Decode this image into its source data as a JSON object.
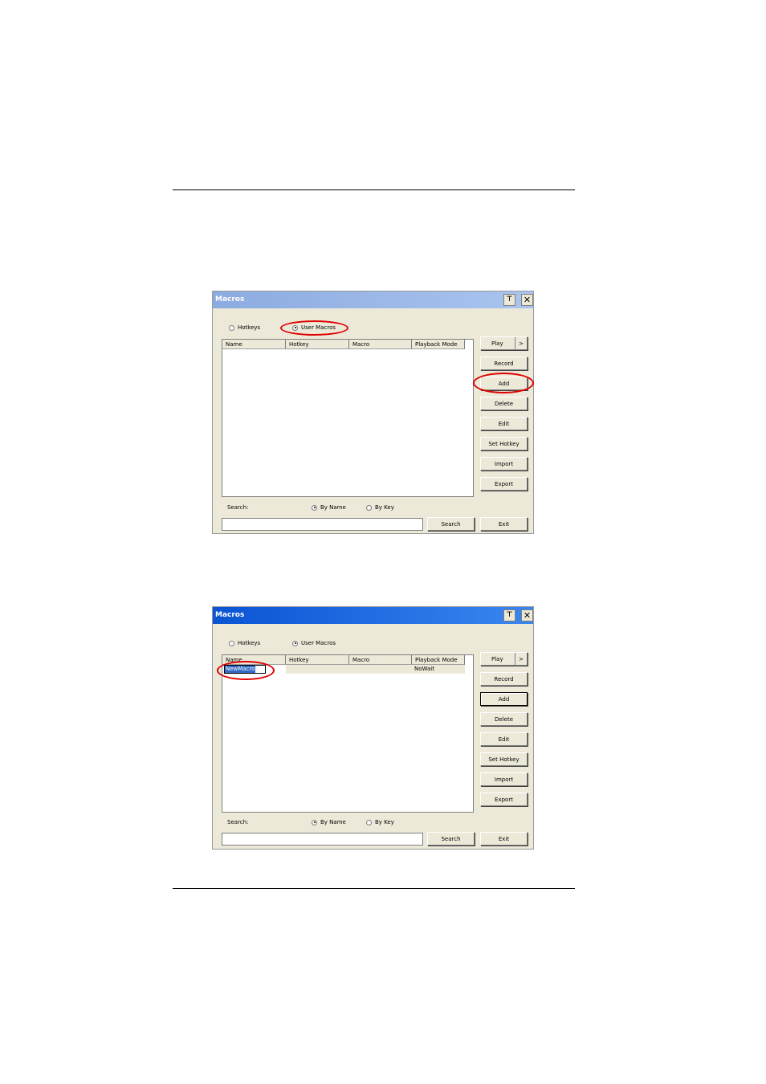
{
  "dialogs": [
    {
      "title": "Macros",
      "window_buttons": {
        "pin": "⊤",
        "close": "✕"
      },
      "radio_hotkeys": "Hotkeys",
      "radio_user_macros": "User Macros",
      "columns": [
        "Name",
        "Hotkey",
        "Macro",
        "Playback Mode"
      ],
      "row": null,
      "buttons": {
        "play": "Play",
        "play_arrow": ">",
        "record": "Record",
        "add": "Add",
        "delete": "Delete",
        "edit": "Edit",
        "set_hotkey": "Set Hotkey",
        "import": "Import",
        "export": "Export"
      },
      "search_label": "Search:",
      "by_name": "By Name",
      "by_key": "By Key",
      "search_value": "",
      "search_button": "Search",
      "exit_button": "Exit"
    },
    {
      "title": "Macros",
      "window_buttons": {
        "pin": "⊤",
        "close": "✕"
      },
      "radio_hotkeys": "Hotkeys",
      "radio_user_macros": "User Macros",
      "columns": [
        "Name",
        "Hotkey",
        "Macro",
        "Playback Mode"
      ],
      "row": {
        "name": "NewMacro",
        "hotkey": "",
        "macro": "",
        "playback_mode": "NoWait"
      },
      "buttons": {
        "play": "Play",
        "play_arrow": ">",
        "record": "Record",
        "add": "Add",
        "delete": "Delete",
        "edit": "Edit",
        "set_hotkey": "Set Hotkey",
        "import": "Import",
        "export": "Export"
      },
      "search_label": "Search:",
      "by_name": "By Name",
      "by_key": "By Key",
      "search_value": "",
      "search_button": "Search",
      "exit_button": "Exit"
    }
  ],
  "colors": {
    "highlight_oval": "#e00000",
    "selection": "#316ac5"
  }
}
